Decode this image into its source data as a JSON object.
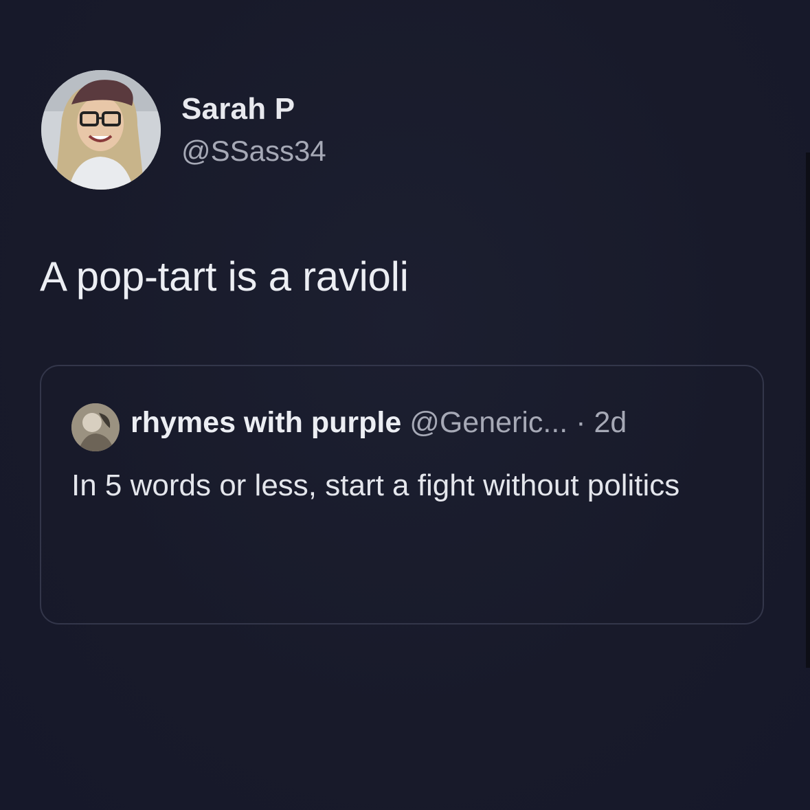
{
  "author": {
    "name": "Sarah P",
    "handle": "@SSass34"
  },
  "tweet": {
    "text": "A pop-tart is a ravioli"
  },
  "quoted_tweet": {
    "name": "rhymes with purple",
    "handle": "@Generic...",
    "separator": "·",
    "time": "2d",
    "text": "In 5 words or less, start a fight without politics"
  },
  "colors": {
    "background": "#181a2a",
    "primary_text": "#eceef3",
    "secondary_text": "#a6a9b6",
    "card_border": "#33364a"
  }
}
